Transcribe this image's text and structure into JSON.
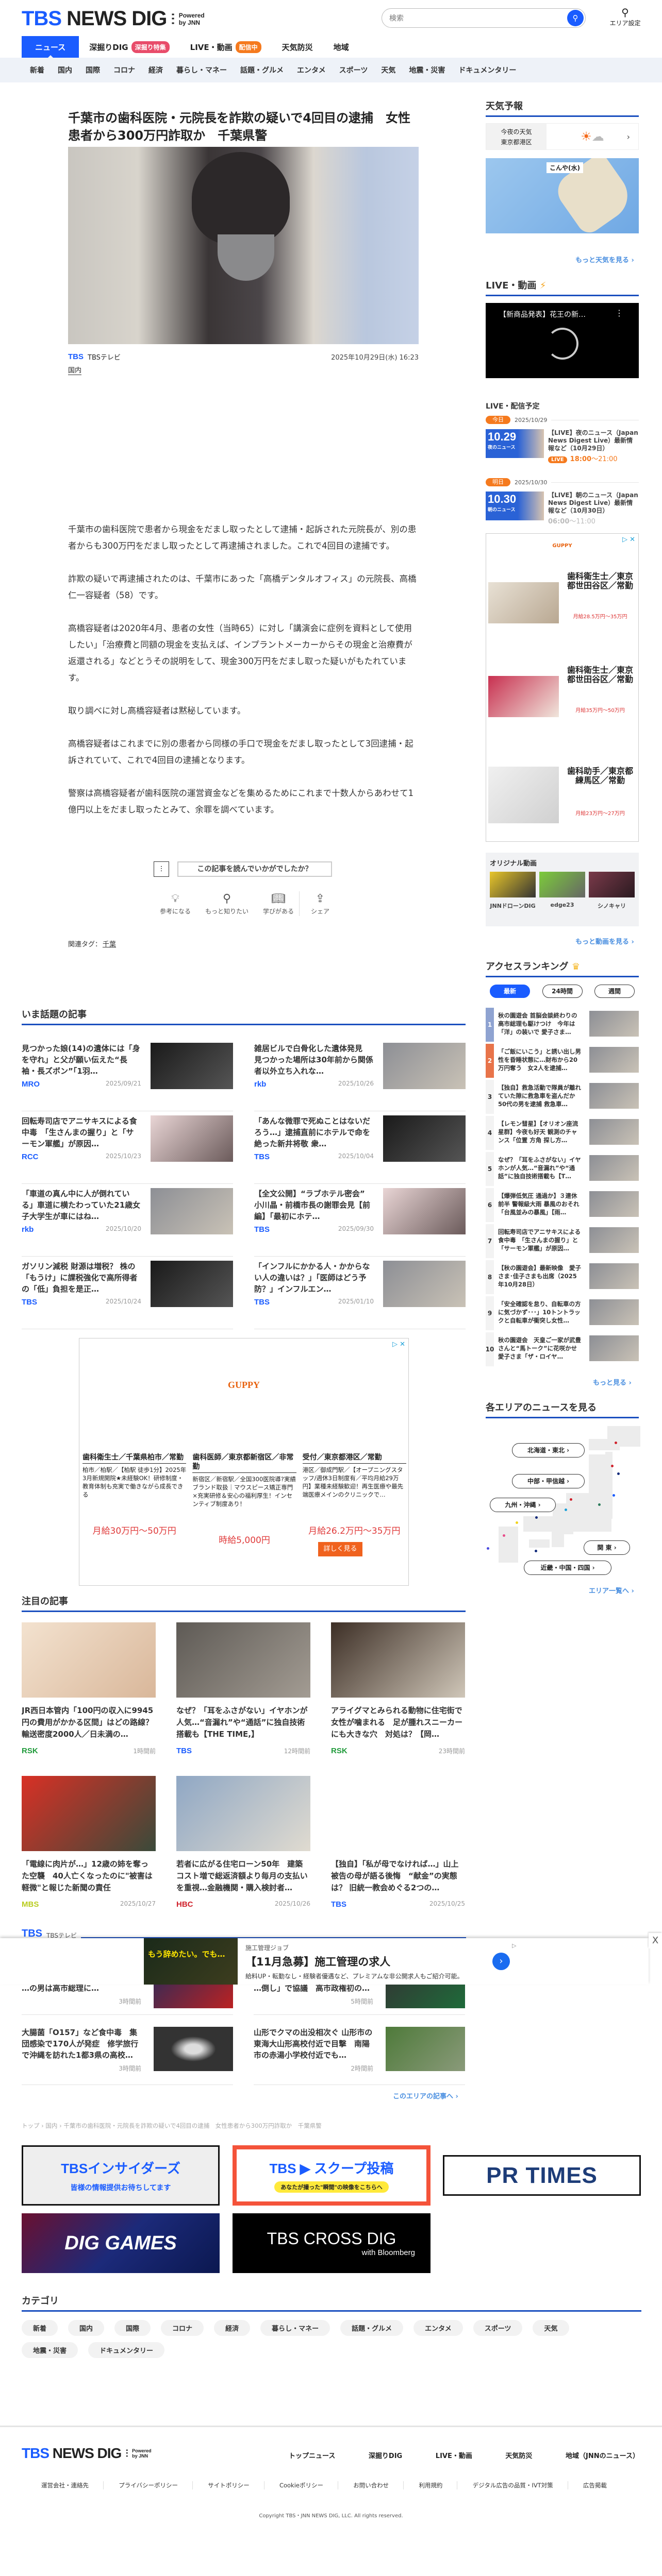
{
  "header": {
    "logo_tbs": "TBS",
    "logo_news": "NEWS DIG",
    "logo_powered": "Powered",
    "logo_by": "by JNN",
    "search_placeholder": "検索",
    "search_icon": "search-icon",
    "area_setting": "エリア設定",
    "tabs": [
      {
        "label": "ニュース"
      },
      {
        "label": "深掘りDIG",
        "badge": "深掘り特集",
        "badge_color": "#e84c6a"
      },
      {
        "label": "LIVE・動画",
        "badge": "配信中",
        "badge_color": "#f57a1e"
      },
      {
        "label": "天気防災"
      },
      {
        "label": "地域"
      }
    ],
    "subnav": [
      "新着",
      "国内",
      "国際",
      "コロナ",
      "経済",
      "暮らし・マネー",
      "話題・グルメ",
      "エンタメ",
      "スポーツ",
      "天気",
      "地震・災害",
      "ドキュメンタリー"
    ]
  },
  "article": {
    "title": "千葉市の歯科医院・元院長を詐欺の疑いで4回目の逮捕　女性患者から300万円詐取か　千葉県警",
    "source_logo": "TBS",
    "source_name": "TBSテレビ",
    "date": "2025年10月29日(水) 16:23",
    "category": "国内",
    "paragraphs": [
      "千葉市の歯科医院で患者から現金をだまし取ったとして逮捕・起訴された元院長が、別の患者からも300万円をだまし取ったとして再逮捕されました。これで4回目の逮捕です。",
      "詐欺の疑いで再逮捕されたのは、千葉市にあった「高橋デンタルオフィス」の元院長、高橋仁一容疑者（58）です。",
      "高橋容疑者は2020年4月、患者の女性（当時65）に対し「講演会に症例を資料として使用したい」「治療費と同額の現金を支払えば、インプラントメーカーからその現金と治療費が返還される」などとうその説明をして、現金300万円をだまし取った疑いがもたれています。",
      "取り調べに対し高橋容疑者は黙秘しています。",
      "高橋容疑者はこれまでに別の患者から同様の手口で現金をだまし取ったとして3回逮捕・起訴されていて、これで4回目の逮捕となります。",
      "警察は高橋容疑者が歯科医院の運営資金などを集めるためにこれまで十数人からあわせて1億円以上をだまし取ったとみて、余罪を調べています。"
    ],
    "feedback_prompt": "この記事を読んでいかがでしたか？",
    "reactions": [
      "参考になる",
      "もっと知りたい",
      "学びがある"
    ],
    "share": "シェア",
    "tags_label": "関連タグ：",
    "tag": "千葉"
  },
  "trending": {
    "heading": "いま話題の記事",
    "items": [
      {
        "title": "見つかった娘(14)の遺体には「身を守れ」と父が願い伝えた“長袖・長ズボン”「1羽…",
        "source": "MRO",
        "date": "2025/09/21"
      },
      {
        "title": "雑居ビルで白骨化した遺体発見　見つかった場所は30年前から関係者以外立ち入れな…",
        "source": "rkb",
        "date": "2025/10/26"
      },
      {
        "title": "回転寿司店でアニサキスによる食中毒　「生さんまの握り」と「サーモン軍艦」が原因…",
        "source": "RCC",
        "date": "2025/10/23"
      },
      {
        "title": "「あんな微罪で死ぬことはないだろう…」逮捕直前にホテルで命を絶った新井将敬 衆…",
        "source": "TBS",
        "date": "2025/10/04"
      },
      {
        "title": "「車道の真ん中に人が倒れている」車道に横たわっていた21歳女子大学生が車にはね…",
        "source": "rkb",
        "date": "2025/10/20"
      },
      {
        "title": "【全文公開】“ラブホテル密会” 小川晶・前橋市長の謝罪会見【前編】「最初にホテ…",
        "source": "TBS",
        "date": "2025/09/30"
      },
      {
        "title": "ガソリン減税 財源は増税？ 株の「もうけ」に課税強化で高所得者の「低」負担を是正…",
        "source": "TBS",
        "date": "2025/10/24"
      },
      {
        "title": "「インフルにかかる人・かからない人の違いは？」「医師はどう予防？」インフルエン…",
        "source": "TBS",
        "date": "2025/01/10"
      }
    ]
  },
  "ad_main": {
    "brand": "GUPPY",
    "jobs": [
      {
        "title": "歯科衛生士／千葉県柏市／常勤",
        "desc": "柏市／柏駅／【柏駅 徒歩1分】2025年3月新規開院★未経験OK！研修制度・教育体制も充実で働きながら成長できる",
        "salary": "月給30万円〜50万円"
      },
      {
        "title": "歯科医師／東京都新宿区／非常勤",
        "desc": "新宿区／新宿駅／全国300医院導?実績ブランド取扱｜マウスピース矯正専門×充実研修＆安心の福利厚生！インセンティブ制度あり！",
        "salary": "時給5,000円"
      },
      {
        "title": "受付／東京都港区／常勤",
        "desc": "港区／御成門駅／【オープニングスタッフ/週休3日制度有／平均月給29万円】業種未経験歓迎！再生医療や最先端医療メインのクリニックで…",
        "salary": "月給26.2万円〜35万円"
      }
    ],
    "cta": "詳しく見る"
  },
  "featured": {
    "heading": "注目の記事",
    "items": [
      {
        "title": "JR西日本管内「100円の収入に9945円の費用がかかる区間」はどの路線？輸送密度2000人／日未満の…",
        "source": "RSK",
        "source_color": "#1f9a3a",
        "time": "1時間前"
      },
      {
        "title": "なぜ？「耳をふさがない」イヤホンが人気…“音漏れ”や“通話”に独自技術搭載も【THE TIME,】",
        "source": "TBS",
        "source_color": "#1a5cff",
        "time": "12時間前"
      },
      {
        "title": "アライグマとみられる動物に住宅街で女性が噛まれる　足が腫れスニーカーにも大きな穴　対処は？【岡…",
        "source": "RSK",
        "source_color": "#1f9a3a",
        "time": "23時間前"
      },
      {
        "title": "「電線に肉片が…」12歳の姉を奪った空襲　40人亡くなったのに\"被害は軽微\"と報じた新聞の責任",
        "source": "MBS",
        "source_color": "#b9cc1e",
        "time": "2025/10/27"
      },
      {
        "title": "若者に広がる住宅ローン50年　建築コスト増で総返済額より毎月の支払いを重視…金融機関・購入検討者…",
        "source": "HBC",
        "source_color": "#d0202a",
        "time": "2025/10/26"
      },
      {
        "title": "【独自】「私が母でなければ…」山上被告の母が語る後悔　“献金”の実態は？ 旧統一教会めぐる2つの…",
        "source": "TBS",
        "source_color": "#1a5cff",
        "time": "2025/10/25"
      }
    ]
  },
  "area": {
    "station_logo": "TBS",
    "station_name": "TBSテレビ",
    "rows": [
      [
        {
          "title": "…の男は高市総理に…",
          "time": "3時間前"
        },
        {
          "title": "…倒し」で協議　高市政権初の…",
          "time": "5時間前"
        }
      ],
      [
        {
          "title": "大腸菌「O157」など食中毒　集団感染で170人が発症　修学旅行で沖縄を訪れた1都3県の高校…",
          "time": "3時間前"
        },
        {
          "title": "山形でクマの出没相次ぐ 山形市の東海大山形高校付近で目撃　南陽市の赤湯小学校付近でも…",
          "time": "2時間前"
        }
      ]
    ],
    "more": "このエリアの記事へ ›"
  },
  "overlay_ad": {
    "image_text": "もう辞めたい。でも…",
    "sponsor": "施工管理ジョブ",
    "headline": "【11月急募】施工管理の求人",
    "desc": "給料UP・転勤なし・経験者優遇など、プレミアムな非公開求人もご紹介可能。",
    "close": "X"
  },
  "breadcrumb": "トップ › 国内 › 千葉市の歯科医院・元院長を詐欺の疑いで4回目の逮捕　女性患者から300万円詐取か　千葉県警",
  "banners": {
    "insiders": "TBSインサイダーズ",
    "insiders_sub": "皆様の情報提供お待ちしてます",
    "scoop": "TBS ▶ スクープ投稿",
    "scoop_sub": "あなたが撮った\"瞬間\"の映像をこちらへ",
    "prtimes": "PR TIMES",
    "games": "DIG GAMES",
    "cross": "TBS CROSS DIG",
    "cross_sub": "with Bloomberg"
  },
  "categories": {
    "heading": "カテゴリ",
    "items": [
      "新着",
      "国内",
      "国際",
      "コロナ",
      "経済",
      "暮らし・マネー",
      "話題・グルメ",
      "エンタメ",
      "スポーツ",
      "天気",
      "地震・災害",
      "ドキュメンタリー"
    ]
  },
  "footer": {
    "nav": [
      "トップニュース",
      "深掘りDIG",
      "LIVE・動画",
      "天気防災",
      "地域（JNNのニュース）"
    ],
    "links": [
      "運営会社・連絡先",
      "プライバシーポリシー",
      "サイトポリシー",
      "Cookieポリシー",
      "お問い合わせ",
      "利用規約",
      "デジタル広告の品質・IVT対策",
      "広告掲載"
    ],
    "copyright": "Copyright TBS・JNN NEWS DIG, LLC. All rights reserved."
  },
  "sidebar": {
    "weather": {
      "heading": "天気予報",
      "label1": "今夜の天気",
      "label2": "東京都港区",
      "icon": "sun-cloud-icon",
      "map_title": "こんや(水)",
      "more": "もっと天気を見る ›"
    },
    "live": {
      "heading": "LIVE・動画",
      "video_title": "【新商品発表】花王の新…"
    },
    "schedule": {
      "heading": "LIVE・配信予定",
      "days": [
        {
          "pill": "今日",
          "date": "2025/10/29",
          "thumb": "10.29",
          "thumb_sub": "夜のニュース",
          "title": "【LIVE】夜のニュース（Japan News Digest Live）最新情報など（10月29日）",
          "live": "LIVE",
          "start": "18:00",
          "end": "～21:00"
        },
        {
          "pill": "明日",
          "date": "2025/10/30",
          "thumb": "10.30",
          "thumb_sub": "朝のニュース",
          "title": "【LIVE】朝のニュース（Japan News Digest Live）最新情報など（10月30日）",
          "start": "06:00",
          "end": "～11:00"
        }
      ]
    },
    "ad": {
      "brand": "GUPPY",
      "items": [
        {
          "title": "歯科衛生士／東京都世田谷区／常勤",
          "salary": "月給28.5万円〜35万円"
        },
        {
          "title": "歯科衛生士／東京都世田谷区／常勤",
          "salary": "月給35万円〜50万円"
        },
        {
          "title": "歯科助手／東京都練馬区／常勤",
          "salary": "月給23万円〜27万円"
        }
      ]
    },
    "original": {
      "heading": "オリジナル動画",
      "items": [
        "JNNドローンDIG",
        "edge23",
        "シノキャリ"
      ],
      "more": "もっと動画を見る ›"
    },
    "ranking": {
      "heading": "アクセスランキング",
      "tabs": [
        "最新",
        "24時間",
        "週間"
      ],
      "items": [
        "秋の園遊会 首脳会談終わりの高市総理も駆けつけ　今年は「洋」の装いで 愛子さま…",
        "「ご飯にいこう」と誘い出し男性を昏睡状態に…財布から20万円奪う　女2人を逮捕…",
        "【独自】救急活動で隊員が離れていた隙に救急車を盗んだか 50代の男を逮捕 救急車…",
        "【レモン彗星】【オリオン座流星群】今夜も好天 観測のチャンス「位置 方角 探し方…",
        "なぜ？「耳をふさがない」イヤホンが人気…“音漏れ”や“通話”に独自技術搭載も【T…",
        "【爆弾低気圧 通過か】３連休前半 警報級大雨 暴風のおそれ「台風並みの暴風」【雨…",
        "回転寿司店でアニサキスによる食中毒　「生さんまの握り」と「サーモン軍艦」が原因…",
        "【秋の園遊会】最新映像　愛子さま･佳子さまも出席（2025年10月28日）",
        "「安全確認を怠り、自転車の方に気づかず･･･」10トントラックと自転車が衝突し女性…",
        "秋の園遊会　天皇ご一家が武豊さんと“馬トーク”に花咲かせ　愛子さま「ザ・ロイヤ…"
      ],
      "more": "もっと見る ›"
    },
    "areas": {
      "heading": "各エリアのニュースを見る",
      "buttons": [
        "北海道・東北 ›",
        "中部・甲信越 ›",
        "九州・沖縄 ›",
        "関 東 ›",
        "近畿・中国・四国 ›"
      ],
      "more": "エリア一覧へ ›"
    }
  }
}
